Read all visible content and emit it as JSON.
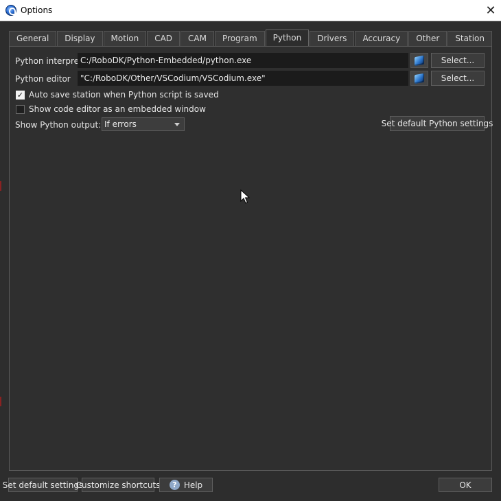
{
  "window": {
    "title": "Options",
    "icon": "robodk-icon"
  },
  "tabs": [
    {
      "label": "General"
    },
    {
      "label": "Display"
    },
    {
      "label": "Motion"
    },
    {
      "label": "CAD"
    },
    {
      "label": "CAM"
    },
    {
      "label": "Program"
    },
    {
      "label": "Python",
      "active": true
    },
    {
      "label": "Drivers"
    },
    {
      "label": "Accuracy"
    },
    {
      "label": "Other"
    },
    {
      "label": "Station"
    }
  ],
  "python": {
    "interpreter_label": "Python interpreter",
    "interpreter_value": "C:/RoboDK/Python-Embedded/python.exe",
    "editor_label": "Python editor",
    "editor_value": "\"C:/RoboDK/Other/VSCodium/VSCodium.exe\"",
    "select_label": "Select...",
    "auto_save_label": "Auto save station when Python script is saved",
    "auto_save_checked": true,
    "embedded_editor_label": "Show code editor as an embedded window",
    "embedded_editor_checked": false,
    "output_label": "Show Python output:",
    "output_value": "If errors",
    "set_default_python_label": "Set default Python settings"
  },
  "footer": {
    "set_default_label": "Set default settings",
    "customize_label": "Customize shortcuts",
    "help_label": "Help",
    "ok_label": "OK"
  },
  "colors": {
    "background": "#2d2d2d",
    "field": "#1b1b1b",
    "text": "#e8e8e8"
  }
}
